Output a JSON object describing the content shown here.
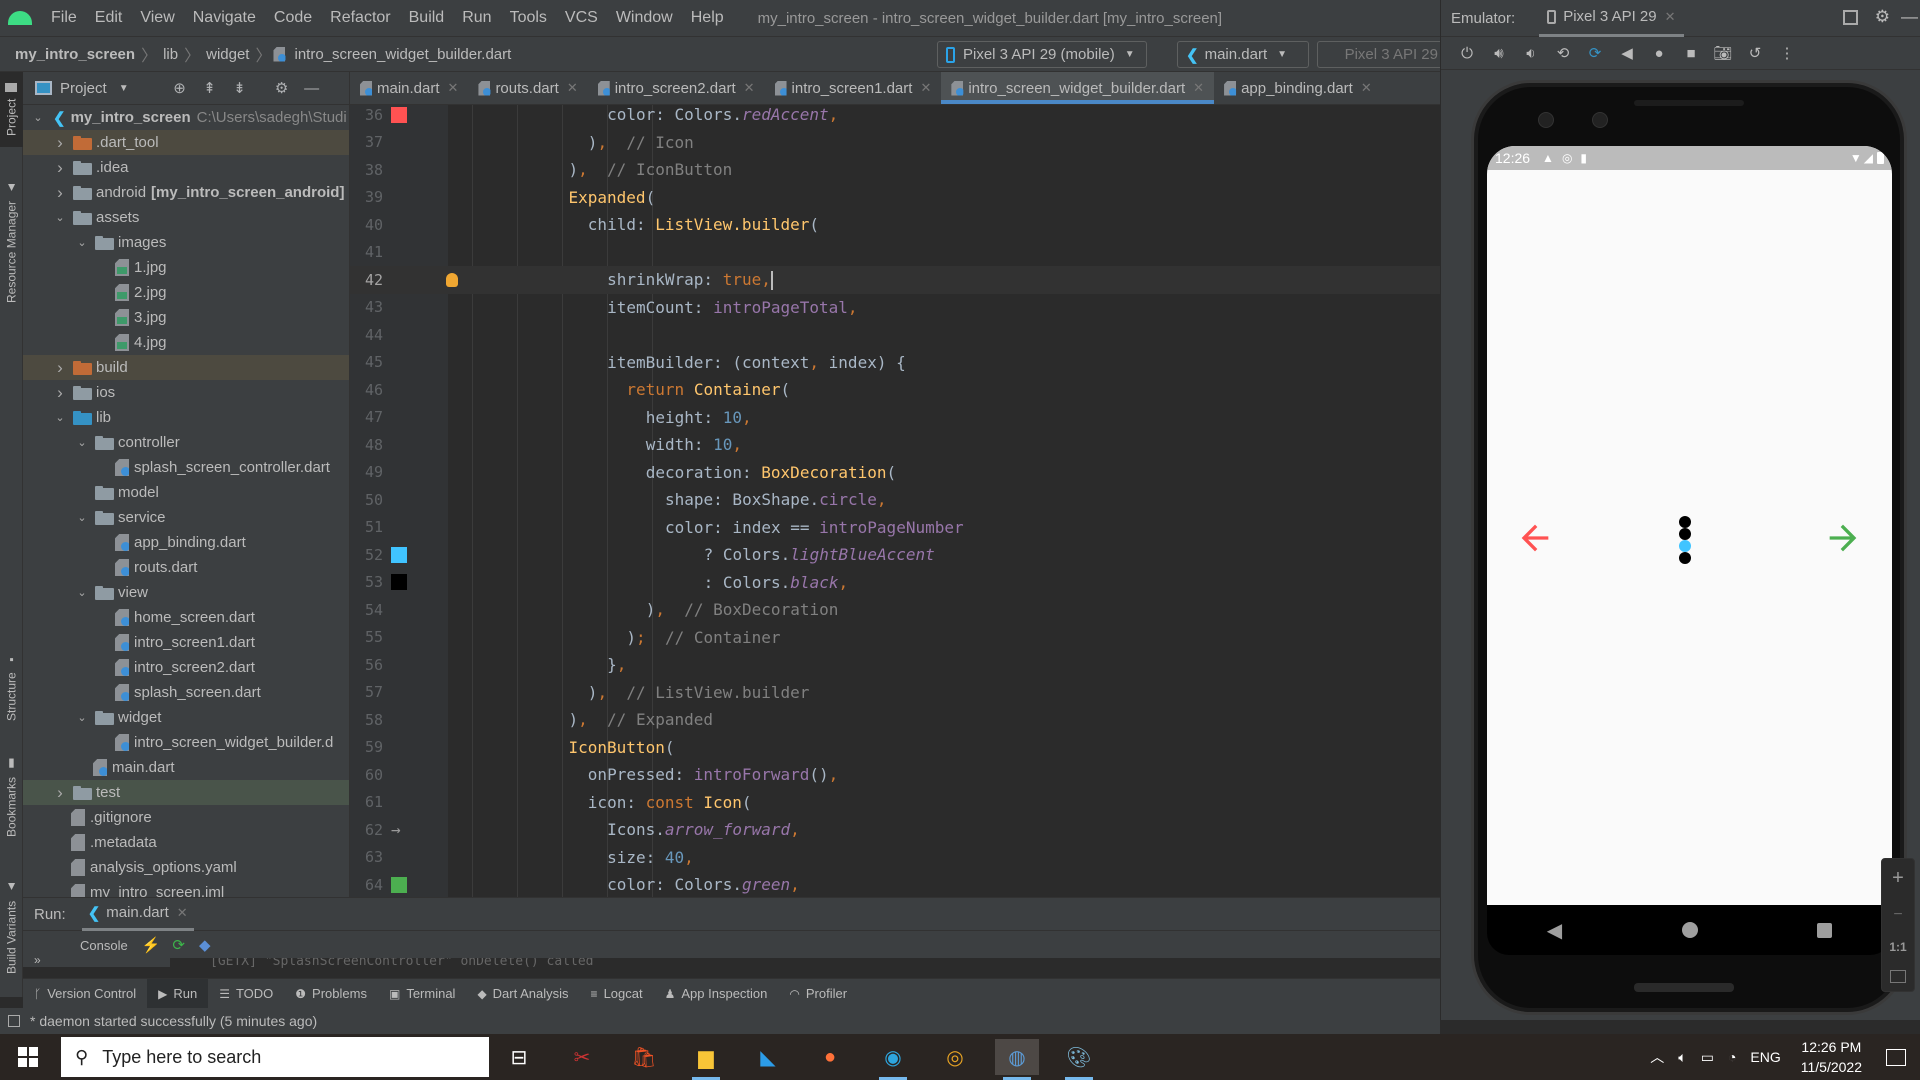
{
  "menubar": {
    "items": [
      "File",
      "Edit",
      "View",
      "Navigate",
      "Code",
      "Refactor",
      "Build",
      "Run",
      "Tools",
      "VCS",
      "Window",
      "Help"
    ],
    "window_title": "my_intro_screen - intro_screen_widget_builder.dart [my_intro_screen]"
  },
  "navbar": {
    "breadcrumbs": [
      "my_intro_screen",
      "lib",
      "widget",
      "intro_screen_widget_builder.dart"
    ],
    "device_dropdown": "Pixel 3 API 29 (mobile)",
    "config_dropdown": "main.dart",
    "device_dropdown_2": "Pixel 3 API 29"
  },
  "left_stripe": {
    "tabs": [
      "Project",
      "Resource Manager",
      "Structure",
      "Bookmarks",
      "Build Variants"
    ]
  },
  "project": {
    "header": "Project",
    "root": {
      "name": "my_intro_screen",
      "path": "C:\\Users\\sadegh\\Studi"
    },
    "tree": [
      {
        "label": ".dart_tool",
        "type": "folder-orange",
        "depth": 1,
        "chevron": ">",
        "hl": "orange"
      },
      {
        "label": ".idea",
        "type": "folder",
        "depth": 1,
        "chevron": ">"
      },
      {
        "label": "android",
        "extra": "[my_intro_screen_android]",
        "type": "folder",
        "depth": 1,
        "chevron": ">"
      },
      {
        "label": "assets",
        "type": "folder",
        "depth": 1,
        "chevron": "v"
      },
      {
        "label": "images",
        "type": "folder",
        "depth": 2,
        "chevron": "v"
      },
      {
        "label": "1.jpg",
        "type": "img",
        "depth": 3
      },
      {
        "label": "2.jpg",
        "type": "img",
        "depth": 3
      },
      {
        "label": "3.jpg",
        "type": "img",
        "depth": 3
      },
      {
        "label": "4.jpg",
        "type": "img",
        "depth": 3
      },
      {
        "label": "build",
        "type": "folder-orange",
        "depth": 1,
        "chevron": ">",
        "hl": "orange"
      },
      {
        "label": "ios",
        "type": "folder",
        "depth": 1,
        "chevron": ">"
      },
      {
        "label": "lib",
        "type": "folder-blue",
        "depth": 1,
        "chevron": "v"
      },
      {
        "label": "controller",
        "type": "folder",
        "depth": 2,
        "chevron": "v"
      },
      {
        "label": "splash_screen_controller.dart",
        "type": "dart",
        "depth": 3
      },
      {
        "label": "model",
        "type": "folder",
        "depth": 2
      },
      {
        "label": "service",
        "type": "folder",
        "depth": 2,
        "chevron": "v"
      },
      {
        "label": "app_binding.dart",
        "type": "dart",
        "depth": 3
      },
      {
        "label": "routs.dart",
        "type": "dart",
        "depth": 3
      },
      {
        "label": "view",
        "type": "folder",
        "depth": 2,
        "chevron": "v"
      },
      {
        "label": "home_screen.dart",
        "type": "dart",
        "depth": 3
      },
      {
        "label": "intro_screen1.dart",
        "type": "dart",
        "depth": 3
      },
      {
        "label": "intro_screen2.dart",
        "type": "dart",
        "depth": 3
      },
      {
        "label": "splash_screen.dart",
        "type": "dart",
        "depth": 3
      },
      {
        "label": "widget",
        "type": "folder",
        "depth": 2,
        "chevron": "v"
      },
      {
        "label": "intro_screen_widget_builder.d",
        "type": "dart",
        "depth": 3
      },
      {
        "label": "main.dart",
        "type": "dart",
        "depth": 2
      },
      {
        "label": "test",
        "type": "folder",
        "depth": 1,
        "chevron": ">",
        "hl": "green"
      },
      {
        "label": ".gitignore",
        "type": "file",
        "depth": 1
      },
      {
        "label": ".metadata",
        "type": "file",
        "depth": 1
      },
      {
        "label": "analysis_options.yaml",
        "type": "yml",
        "depth": 1
      },
      {
        "label": "my_intro_screen.iml",
        "type": "file",
        "depth": 1
      }
    ]
  },
  "tabs": [
    {
      "label": "main.dart",
      "active": false
    },
    {
      "label": "routs.dart",
      "active": false
    },
    {
      "label": "intro_screen2.dart",
      "active": false
    },
    {
      "label": "intro_screen1.dart",
      "active": false
    },
    {
      "label": "intro_screen_widget_builder.dart",
      "active": true
    },
    {
      "label": "app_binding.dart",
      "active": false
    }
  ],
  "editor": {
    "current_line": 42,
    "lines": [
      {
        "n": 36,
        "indent": 14,
        "swatch": "#ff5252",
        "tokens": [
          [
            "pl",
            "color: Colors."
          ],
          [
            "it",
            "redAccent"
          ],
          [
            "pu",
            ","
          ]
        ]
      },
      {
        "n": 37,
        "indent": 12,
        "tokens": [
          [
            "pl",
            ")"
          ],
          [
            "pu",
            ","
          ],
          [
            "cm",
            "  // Icon"
          ]
        ]
      },
      {
        "n": 38,
        "indent": 10,
        "tokens": [
          [
            "pl",
            ")"
          ],
          [
            "pu",
            ","
          ],
          [
            "cm",
            "  // IconButton"
          ]
        ]
      },
      {
        "n": 39,
        "indent": 10,
        "tokens": [
          [
            "cls",
            "Expanded"
          ],
          [
            "pl",
            "("
          ]
        ]
      },
      {
        "n": 40,
        "indent": 12,
        "tokens": [
          [
            "pl",
            "child: "
          ],
          [
            "cls",
            "ListView.builder"
          ],
          [
            "pl",
            "("
          ]
        ]
      },
      {
        "n": 41,
        "indent": 0,
        "tokens": []
      },
      {
        "n": 42,
        "indent": 14,
        "tokens": [
          [
            "pl",
            "shrinkWrap: "
          ],
          [
            "kw",
            "true"
          ],
          [
            "pu",
            ","
          ]
        ],
        "caret": true
      },
      {
        "n": 43,
        "indent": 14,
        "tokens": [
          [
            "pl",
            "itemCount: "
          ],
          [
            "field",
            "introPageTotal"
          ],
          [
            "pu",
            ","
          ]
        ]
      },
      {
        "n": 44,
        "indent": 0,
        "tokens": []
      },
      {
        "n": 45,
        "indent": 14,
        "tokens": [
          [
            "pl",
            "itemBuilder: (context"
          ],
          [
            "pu",
            ","
          ],
          [
            "pl",
            " index) {"
          ]
        ]
      },
      {
        "n": 46,
        "indent": 16,
        "tokens": [
          [
            "kw",
            "return "
          ],
          [
            "cls",
            "Container"
          ],
          [
            "pl",
            "("
          ]
        ]
      },
      {
        "n": 47,
        "indent": 18,
        "tokens": [
          [
            "pl",
            "height: "
          ],
          [
            "num",
            "10"
          ],
          [
            "pu",
            ","
          ]
        ]
      },
      {
        "n": 48,
        "indent": 18,
        "tokens": [
          [
            "pl",
            "width: "
          ],
          [
            "num",
            "10"
          ],
          [
            "pu",
            ","
          ]
        ]
      },
      {
        "n": 49,
        "indent": 18,
        "tokens": [
          [
            "pl",
            "decoration: "
          ],
          [
            "cls",
            "BoxDecoration"
          ],
          [
            "pl",
            "("
          ]
        ]
      },
      {
        "n": 50,
        "indent": 20,
        "tokens": [
          [
            "pl",
            "shape: BoxShape."
          ],
          [
            "field",
            "circle"
          ],
          [
            "pu",
            ","
          ]
        ]
      },
      {
        "n": 51,
        "indent": 20,
        "tokens": [
          [
            "pl",
            "color: index == "
          ],
          [
            "field",
            "introPageNumber"
          ]
        ]
      },
      {
        "n": 52,
        "indent": 24,
        "swatch": "#40c4ff",
        "tokens": [
          [
            "pl",
            "? Colors."
          ],
          [
            "it",
            "lightBlueAccent"
          ]
        ]
      },
      {
        "n": 53,
        "indent": 24,
        "swatch": "#000000",
        "tokens": [
          [
            "pl",
            ": Colors."
          ],
          [
            "it",
            "black"
          ],
          [
            "pu",
            ","
          ]
        ]
      },
      {
        "n": 54,
        "indent": 18,
        "tokens": [
          [
            "pl",
            ")"
          ],
          [
            "pu",
            ","
          ],
          [
            "cm",
            "  // BoxDecoration"
          ]
        ]
      },
      {
        "n": 55,
        "indent": 16,
        "tokens": [
          [
            "pl",
            ")"
          ],
          [
            "pu",
            ";"
          ],
          [
            "cm",
            "  // Container"
          ]
        ]
      },
      {
        "n": 56,
        "indent": 14,
        "tokens": [
          [
            "pl",
            "}"
          ],
          [
            "pu",
            ","
          ]
        ]
      },
      {
        "n": 57,
        "indent": 12,
        "tokens": [
          [
            "pl",
            ")"
          ],
          [
            "pu",
            ","
          ],
          [
            "cm",
            "  // ListView.builder"
          ]
        ]
      },
      {
        "n": 58,
        "indent": 10,
        "tokens": [
          [
            "pl",
            ")"
          ],
          [
            "pu",
            ","
          ],
          [
            "cm",
            "  // Expanded"
          ]
        ]
      },
      {
        "n": 59,
        "indent": 10,
        "tokens": [
          [
            "cls",
            "IconButton"
          ],
          [
            "pl",
            "("
          ]
        ]
      },
      {
        "n": 60,
        "indent": 12,
        "tokens": [
          [
            "pl",
            "onPressed: "
          ],
          [
            "field",
            "introForward"
          ],
          [
            "pl",
            "()"
          ],
          [
            "pu",
            ","
          ]
        ]
      },
      {
        "n": 61,
        "indent": 12,
        "tokens": [
          [
            "pl",
            "icon: "
          ],
          [
            "kw",
            "const "
          ],
          [
            "cls",
            "Icon"
          ],
          [
            "pl",
            "("
          ]
        ]
      },
      {
        "n": 62,
        "indent": 14,
        "gutter_icon": "→",
        "tokens": [
          [
            "pl",
            "Icons."
          ],
          [
            "it",
            "arrow_forward"
          ],
          [
            "pu",
            ","
          ]
        ]
      },
      {
        "n": 63,
        "indent": 14,
        "tokens": [
          [
            "pl",
            "size: "
          ],
          [
            "num",
            "40"
          ],
          [
            "pu",
            ","
          ]
        ]
      },
      {
        "n": 64,
        "indent": 14,
        "swatch": "#4caf50",
        "tokens": [
          [
            "pl",
            "color: Colors."
          ],
          [
            "it",
            "green"
          ],
          [
            "pu",
            ","
          ]
        ]
      }
    ]
  },
  "run": {
    "label": "Run:",
    "tab": "main.dart",
    "console": "Console",
    "console_text": "[GETX] \"SplashScreenController\" onDelete() called"
  },
  "toolwindows": [
    {
      "label": "Version Control",
      "icon": "branch-icon"
    },
    {
      "label": "Run",
      "icon": "play-icon",
      "active": true
    },
    {
      "label": "TODO",
      "icon": "list-icon"
    },
    {
      "label": "Problems",
      "icon": "warning-icon"
    },
    {
      "label": "Terminal",
      "icon": "terminal-icon"
    },
    {
      "label": "Dart Analysis",
      "icon": "dart-icon"
    },
    {
      "label": "Logcat",
      "icon": "logcat-icon"
    },
    {
      "label": "App Inspection",
      "icon": "inspection-icon"
    },
    {
      "label": "Profiler",
      "icon": "profiler-icon"
    }
  ],
  "status": {
    "message": "* daemon started successfully (5 minutes ago)"
  },
  "emulator": {
    "label": "Emulator:",
    "device_tab": "Pixel 3 API 29",
    "phone": {
      "time": "12:26",
      "page_dots": {
        "total": 4,
        "active_index": 2,
        "active_color": "#40c4ff",
        "inactive_color": "#000000"
      },
      "back_arrow_color": "#ff5252",
      "forward_arrow_color": "#4caf50"
    },
    "zoom_controls": [
      "+",
      "−",
      "1:1"
    ]
  },
  "taskbar": {
    "search_placeholder": "Type here to search",
    "language": "ENG",
    "time": "12:26 PM",
    "date": "11/5/2022"
  }
}
